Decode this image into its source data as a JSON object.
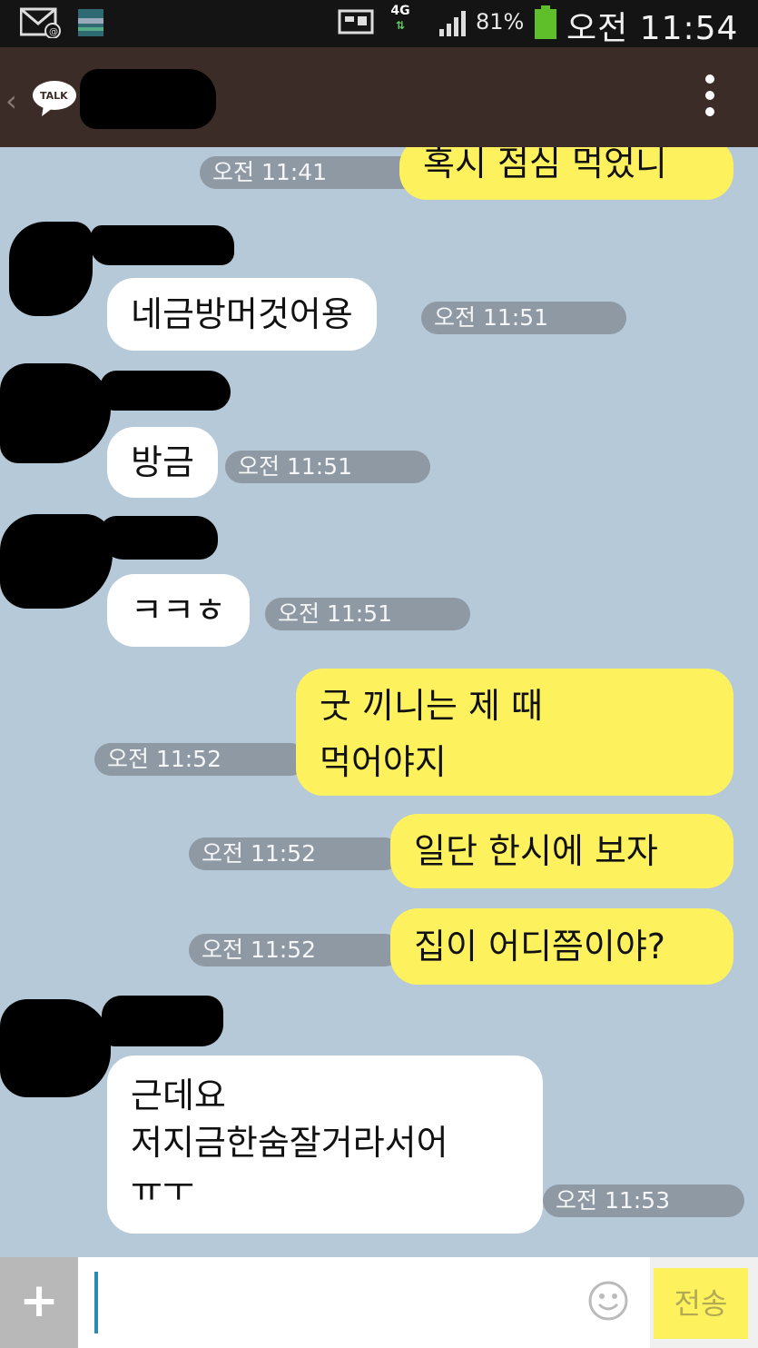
{
  "status_bar": {
    "network": "4G",
    "battery_percent": "81%",
    "time": "오전 11:54"
  },
  "header": {
    "logo_text": "TALK"
  },
  "messages": [
    {
      "sender": "me",
      "text": "혹시 점심 먹었니",
      "time": "오전 11:41"
    },
    {
      "sender": "them",
      "text": "네금방머것어용",
      "time": "오전 11:51"
    },
    {
      "sender": "them",
      "text": "방금",
      "time": "오전 11:51"
    },
    {
      "sender": "them",
      "text": "ㅋㅋㅎ",
      "time": "오전 11:51"
    },
    {
      "sender": "me",
      "text_lines": [
        "굿 끼니는 제 때",
        "먹어야지"
      ],
      "time": "오전 11:52"
    },
    {
      "sender": "me",
      "text": "일단 한시에 보자",
      "time": "오전 11:52"
    },
    {
      "sender": "me",
      "text": "집이 어디쯤이야?",
      "time": "오전 11:52"
    },
    {
      "sender": "them",
      "text_lines": [
        "근데요",
        "저지금한숨잘거라서어",
        "ㅠㅜ"
      ],
      "time": "오전 11:53"
    }
  ],
  "input": {
    "value": "",
    "send_label": "전송"
  },
  "colors": {
    "chat_bg": "#b6c9d8",
    "my_bubble": "#fdf25e",
    "their_bubble": "#ffffff",
    "header_bg": "#3c2c27"
  }
}
